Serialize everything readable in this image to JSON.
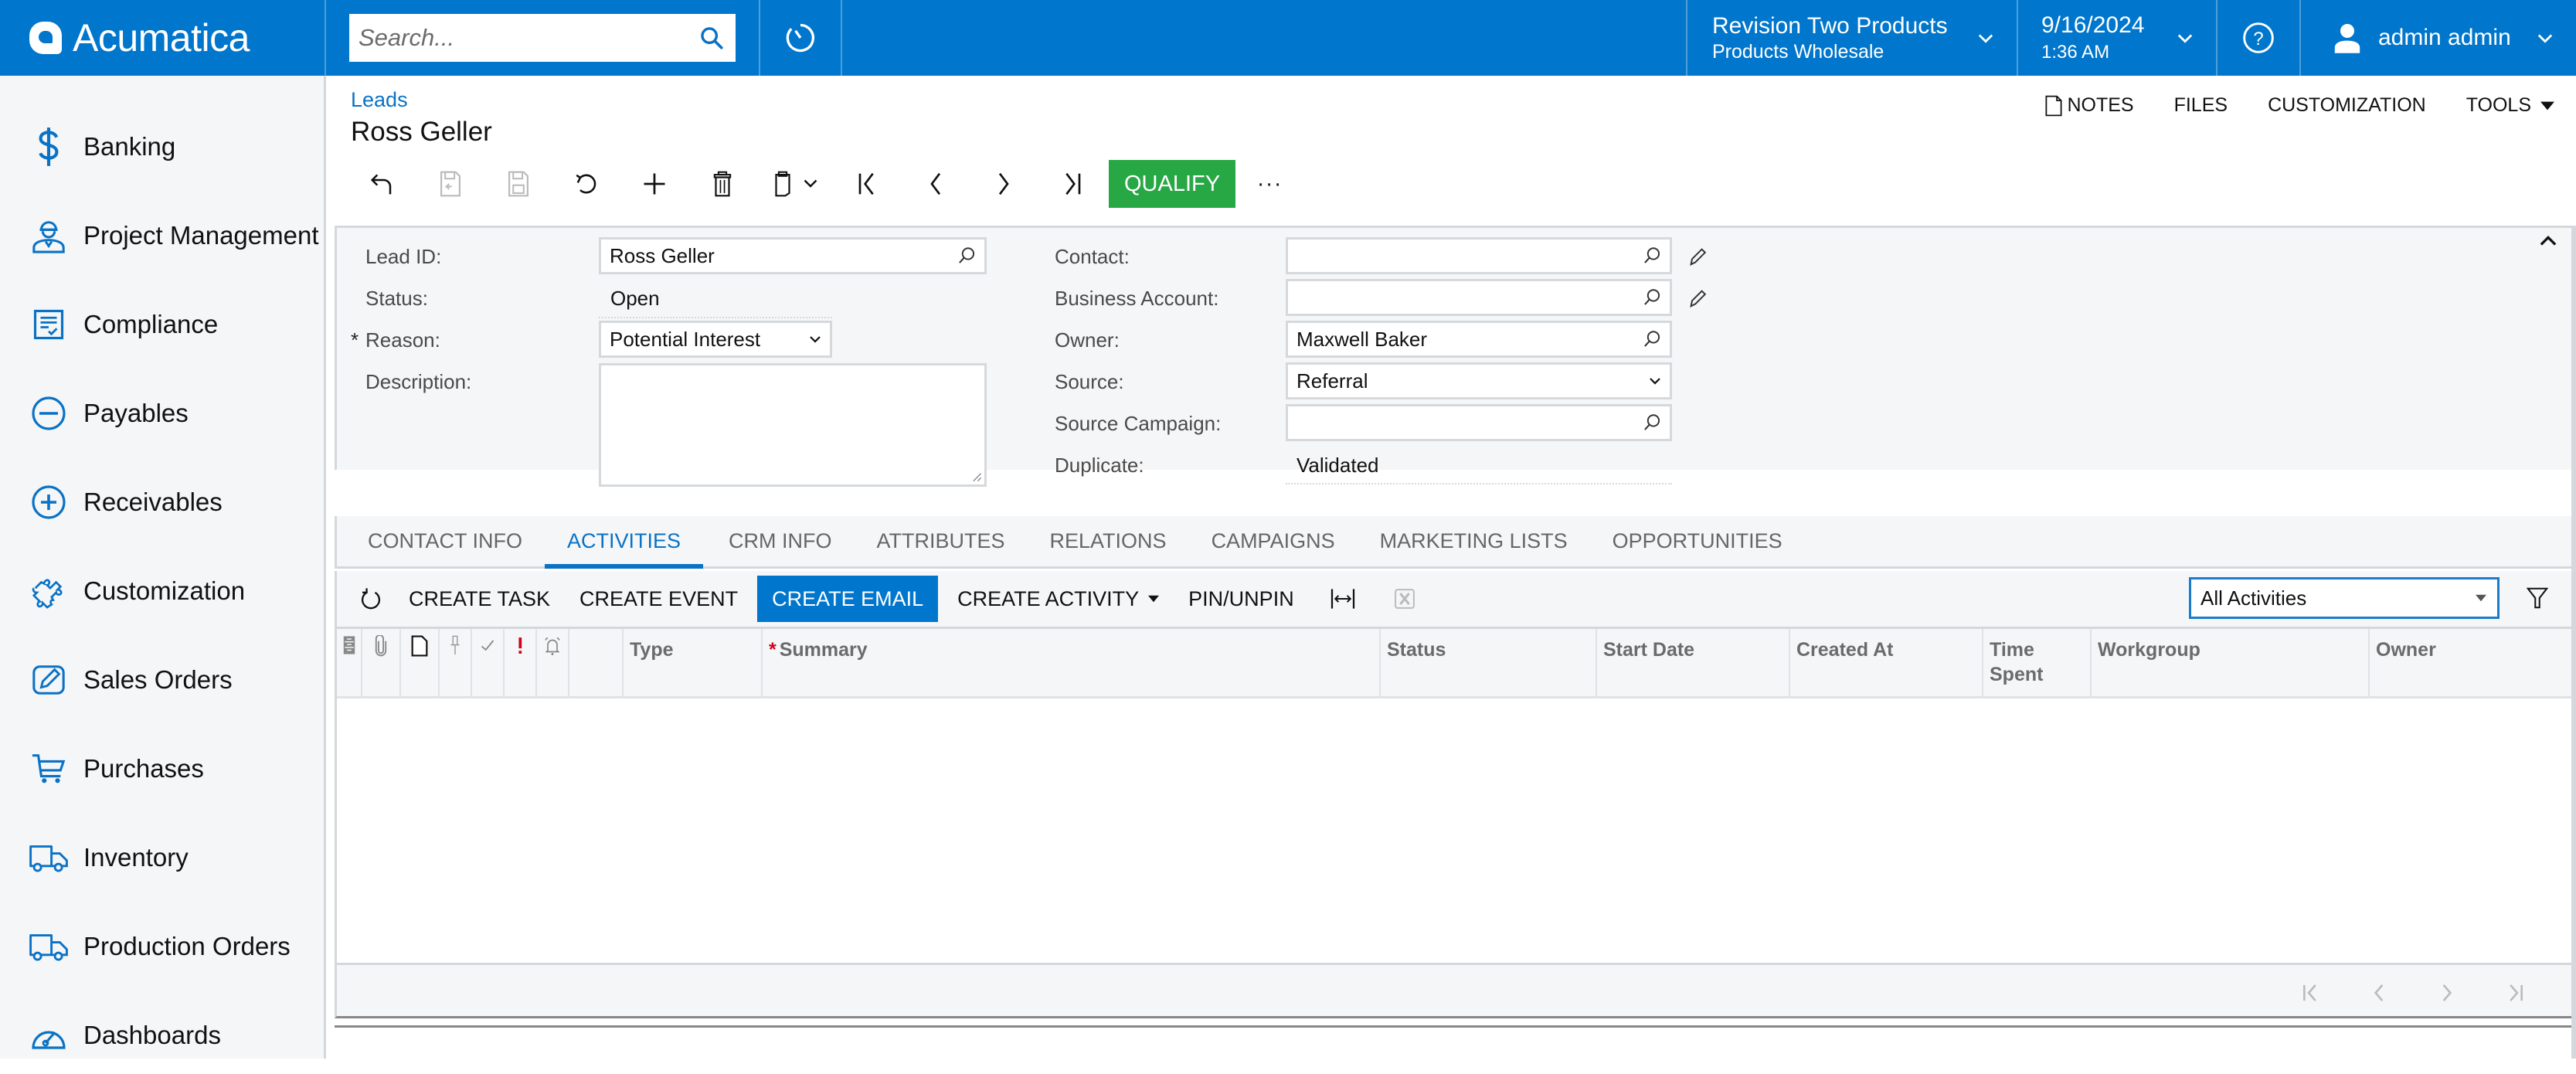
{
  "app": {
    "brand": "Acumatica",
    "search_placeholder": "Search...",
    "company": {
      "name": "Revision Two Products",
      "branch": "Products Wholesale"
    },
    "datetime": {
      "date": "9/16/2024",
      "time": "1:36 AM"
    },
    "user": "admin admin",
    "accent_color": "#0076cc"
  },
  "sidebar": {
    "items": [
      {
        "label": "Banking",
        "icon": "dollar-icon"
      },
      {
        "label": "Project Management",
        "icon": "worker-icon"
      },
      {
        "label": "Compliance",
        "icon": "checklist-icon"
      },
      {
        "label": "Payables",
        "icon": "minus-circle-icon"
      },
      {
        "label": "Receivables",
        "icon": "plus-circle-icon"
      },
      {
        "label": "Customization",
        "icon": "puzzle-icon"
      },
      {
        "label": "Sales Orders",
        "icon": "edit-icon"
      },
      {
        "label": "Purchases",
        "icon": "cart-icon"
      },
      {
        "label": "Inventory",
        "icon": "truck-icon"
      },
      {
        "label": "Production Orders",
        "icon": "truck-icon"
      },
      {
        "label": "Dashboards",
        "icon": "gauge-icon"
      }
    ]
  },
  "header": {
    "breadcrumb": "Leads",
    "title": "Ross Geller",
    "links": {
      "notes": "NOTES",
      "files": "FILES",
      "customization": "CUSTOMIZATION",
      "tools": "TOOLS"
    }
  },
  "toolbar": {
    "qualify_label": "QUALIFY",
    "qualify_color": "#28a745",
    "more_label": "···"
  },
  "form": {
    "lead_id": {
      "label": "Lead ID:",
      "value": "Ross Geller"
    },
    "status": {
      "label": "Status:",
      "value": "Open"
    },
    "reason": {
      "label": "Reason:",
      "value": "Potential Interest",
      "required_mark": "*"
    },
    "description": {
      "label": "Description:",
      "value": ""
    },
    "contact": {
      "label": "Contact:",
      "value": ""
    },
    "business_account": {
      "label": "Business Account:",
      "value": ""
    },
    "owner": {
      "label": "Owner:",
      "value": "Maxwell Baker"
    },
    "source": {
      "label": "Source:",
      "value": "Referral"
    },
    "source_campaign": {
      "label": "Source Campaign:",
      "value": ""
    },
    "duplicate": {
      "label": "Duplicate:",
      "value": "Validated"
    }
  },
  "tabs": [
    {
      "label": "CONTACT INFO",
      "active": false
    },
    {
      "label": "ACTIVITIES",
      "active": true
    },
    {
      "label": "CRM INFO",
      "active": false
    },
    {
      "label": "ATTRIBUTES",
      "active": false
    },
    {
      "label": "RELATIONS",
      "active": false
    },
    {
      "label": "CAMPAIGNS",
      "active": false
    },
    {
      "label": "MARKETING LISTS",
      "active": false
    },
    {
      "label": "OPPORTUNITIES",
      "active": false
    }
  ],
  "activities": {
    "buttons": {
      "create_task": "CREATE TASK",
      "create_event": "CREATE EVENT",
      "create_email": "CREATE EMAIL",
      "create_activity": "CREATE ACTIVITY",
      "pin_unpin": "PIN/UNPIN"
    },
    "filter": {
      "value": "All Activities"
    },
    "columns": {
      "type": "Type",
      "summary": "Summary",
      "summary_required": "*",
      "status": "Status",
      "start_date": "Start Date",
      "created_at": "Created At",
      "time_spent_1": "Time",
      "time_spent_2": "Spent",
      "workgroup": "Workgroup",
      "owner": "Owner"
    },
    "rows": []
  }
}
